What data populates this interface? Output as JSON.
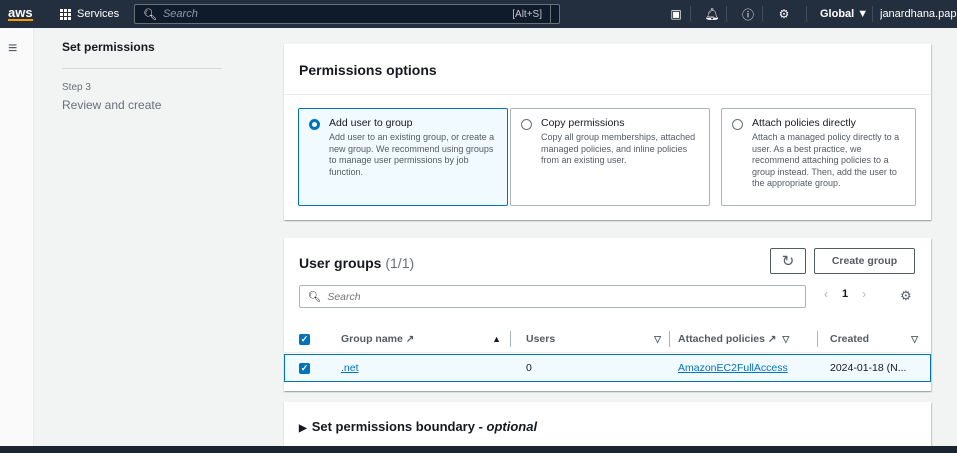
{
  "topnav": {
    "logo": "aws",
    "services_label": "Services",
    "search_placeholder": "Search",
    "search_shortcut": "[Alt+S]",
    "region_label": "Global ▼",
    "user_label": "janardhana.pap"
  },
  "wizard_nav": {
    "current_step_label": "Set permissions",
    "step3_number": "Step 3",
    "step3_label": "Review and create"
  },
  "permissions_options": {
    "title": "Permissions options",
    "options": [
      {
        "title": "Add user to group",
        "description": "Add user to an existing group, or create a new group. We recommend using groups to manage user permissions by job function.",
        "selected": true
      },
      {
        "title": "Copy permissions",
        "description": "Copy all group memberships, attached managed policies, and inline policies from an existing user.",
        "selected": false
      },
      {
        "title": "Attach policies directly",
        "description": "Attach a managed policy directly to a user. As a best practice, we recommend attaching policies to a group instead. Then, add the user to the appropriate group.",
        "selected": false
      }
    ]
  },
  "user_groups": {
    "title": "User groups",
    "count": "(1/1)",
    "create_button": "Create group",
    "search_placeholder": "Search",
    "page_number": "1",
    "columns": [
      "Group name",
      "Users",
      "Attached policies",
      "Created"
    ],
    "rows": [
      {
        "group_name": ".net",
        "users": "0",
        "attached_policies": "AmazonEC2FullAccess",
        "created": "2024-01-18 (N..."
      }
    ]
  },
  "boundary": {
    "title_prefix": "Set permissions boundary - ",
    "title_optional": "optional"
  },
  "colors": {
    "nav_bg": "#232f3e",
    "accent": "#0073bb",
    "brand_orange": "#ff9900"
  }
}
